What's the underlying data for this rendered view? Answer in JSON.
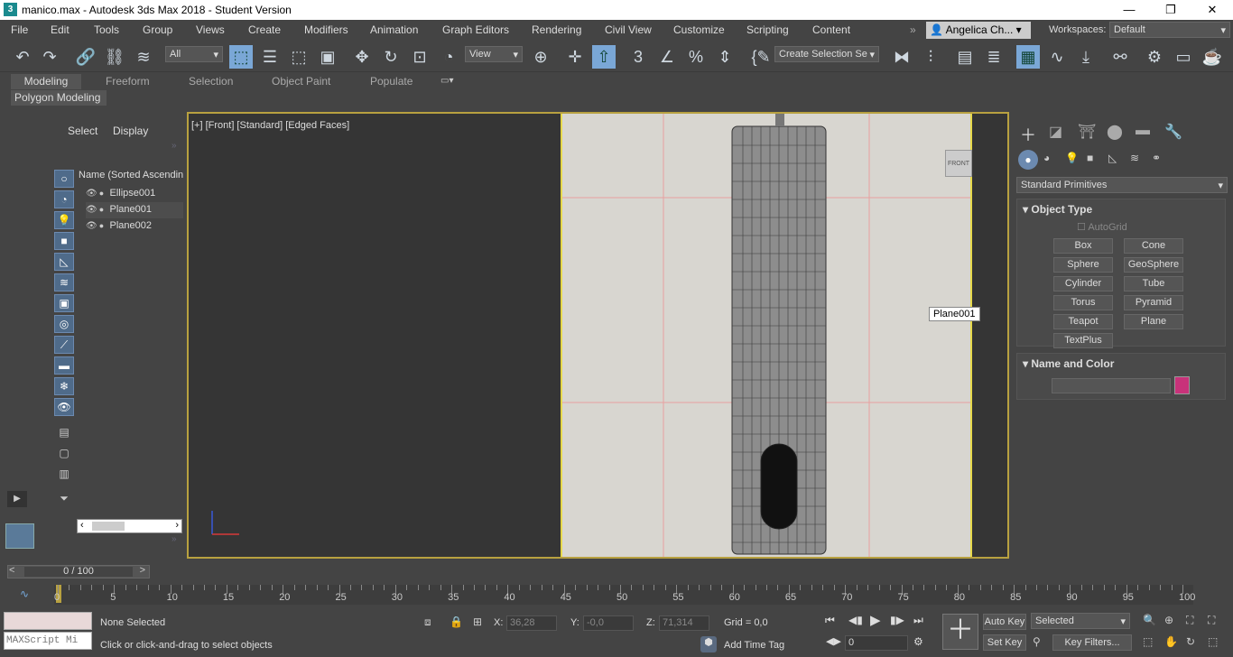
{
  "window": {
    "title": "manico.max - Autodesk 3ds Max 2018 - Student Version",
    "icon": "3"
  },
  "menus": [
    "File",
    "Edit",
    "Tools",
    "Group",
    "Views",
    "Create",
    "Modifiers",
    "Animation",
    "Graph Editors",
    "Rendering",
    "Civil View",
    "Customize",
    "Scripting",
    "Content"
  ],
  "user": {
    "name": "Angelica Ch...",
    "workspaces_label": "Workspaces:",
    "workspace": "Default"
  },
  "toolbar": {
    "filter": "All",
    "ref_coord": "View",
    "selection_set": "Create Selection Se"
  },
  "ribbon": {
    "tabs": [
      "Modeling",
      "Freeform",
      "Selection",
      "Object Paint",
      "Populate"
    ],
    "sub": "Polygon Modeling"
  },
  "scene_explorer": {
    "tabs": [
      "Select",
      "Display"
    ],
    "column": "Name (Sorted Ascending",
    "items": [
      "Ellipse001",
      "Plane001",
      "Plane002"
    ]
  },
  "viewport": {
    "label": "[+] [Front] [Standard] [Edged Faces]",
    "viewcube": "FRONT",
    "tooltip": "Plane001"
  },
  "command_panel": {
    "category": "Standard Primitives",
    "object_type": {
      "title": "Object Type",
      "autogrid": "AutoGrid",
      "buttons": [
        "Box",
        "Cone",
        "Sphere",
        "GeoSphere",
        "Cylinder",
        "Tube",
        "Torus",
        "Pyramid",
        "Teapot",
        "Plane",
        "TextPlus"
      ]
    },
    "name_color": {
      "title": "Name and Color",
      "color": "#c8327a"
    }
  },
  "timeline": {
    "frame": "0 / 100",
    "ticks": [
      "0",
      "5",
      "10",
      "15",
      "20",
      "25",
      "30",
      "35",
      "40",
      "45",
      "50",
      "55",
      "60",
      "65",
      "70",
      "75",
      "80",
      "85",
      "90",
      "95",
      "100"
    ]
  },
  "status": {
    "selection": "None Selected",
    "prompt": "Click or click-and-drag to select objects",
    "maxscript": "MAXScript Mi",
    "x_label": "X:",
    "x": "36,28",
    "y_label": "Y:",
    "y": "-0,0",
    "z_label": "Z:",
    "z": "71,314",
    "grid": "Grid = 0,0",
    "add_time_tag": "Add Time Tag",
    "auto_key": "Auto Key",
    "set_key": "Set Key",
    "selected": "Selected",
    "key_filters": "Key Filters...",
    "frame_field": "0"
  }
}
